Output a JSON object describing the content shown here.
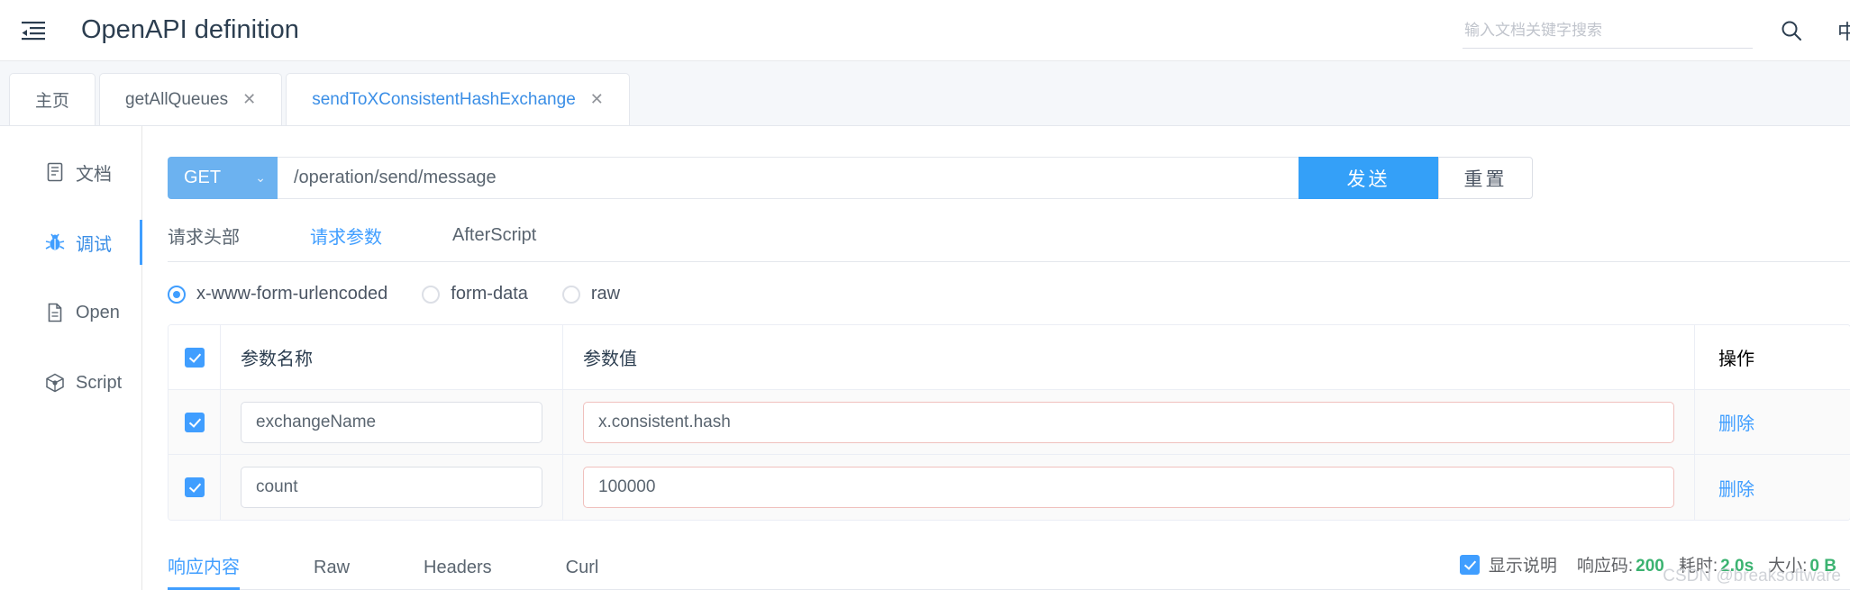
{
  "header": {
    "collapse_icon": "menu-collapse-icon",
    "title": "OpenAPI definition",
    "search_placeholder": "输入文档关键字搜索",
    "search_value": "",
    "search_icon": "search-icon",
    "lang_toggle": "中"
  },
  "tabs": [
    {
      "label": "主页",
      "closable": false,
      "active": false
    },
    {
      "label": "getAllQueues",
      "closable": true,
      "active": false,
      "close": "✕"
    },
    {
      "label": "sendToXConsistentHashExchange",
      "closable": true,
      "active": true,
      "close": "✕"
    }
  ],
  "sidebar": {
    "items": [
      {
        "label": "文档",
        "icon": "document-icon",
        "active": false
      },
      {
        "label": "调试",
        "icon": "bug-icon",
        "active": true
      },
      {
        "label": "Open",
        "icon": "file-icon",
        "active": false
      },
      {
        "label": "Script",
        "icon": "cube-icon",
        "active": false
      }
    ]
  },
  "request": {
    "method": "GET",
    "method_caret": "⌄",
    "url": "/operation/send/message",
    "send_label": "发送",
    "reset_label": "重置"
  },
  "inner_tabs": [
    {
      "label": "请求头部",
      "active": false
    },
    {
      "label": "请求参数",
      "active": true
    },
    {
      "label": "AfterScript",
      "active": false
    }
  ],
  "body_type": {
    "options": [
      {
        "label": "x-www-form-urlencoded",
        "checked": true
      },
      {
        "label": "form-data",
        "checked": false
      },
      {
        "label": "raw",
        "checked": false
      }
    ]
  },
  "params_table": {
    "headers": {
      "name": "参数名称",
      "value": "参数值",
      "op": "操作"
    },
    "header_checked": true,
    "rows": [
      {
        "checked": true,
        "name": "exchangeName",
        "value": "x.consistent.hash",
        "op": "删除"
      },
      {
        "checked": true,
        "name": "count",
        "value": "100000",
        "op": "删除"
      }
    ]
  },
  "response": {
    "tabs": [
      {
        "label": "响应内容",
        "active": true
      },
      {
        "label": "Raw",
        "active": false
      },
      {
        "label": "Headers",
        "active": false
      },
      {
        "label": "Curl",
        "active": false
      }
    ],
    "show_desc_checked": true,
    "show_desc_label": "显示说明",
    "status_code_label": "响应码:",
    "status_code_value": "200",
    "time_label": "耗时:",
    "time_value": "2.0s",
    "size_label": "大小:",
    "size_value": "0 B"
  },
  "watermark": "CSDN @breaksoftware",
  "colors": {
    "accent": "#409eff",
    "method": "#6cb2f0",
    "send": "#34a0f8",
    "success": "#3cb371",
    "warn_border": "#f0c0bd"
  }
}
